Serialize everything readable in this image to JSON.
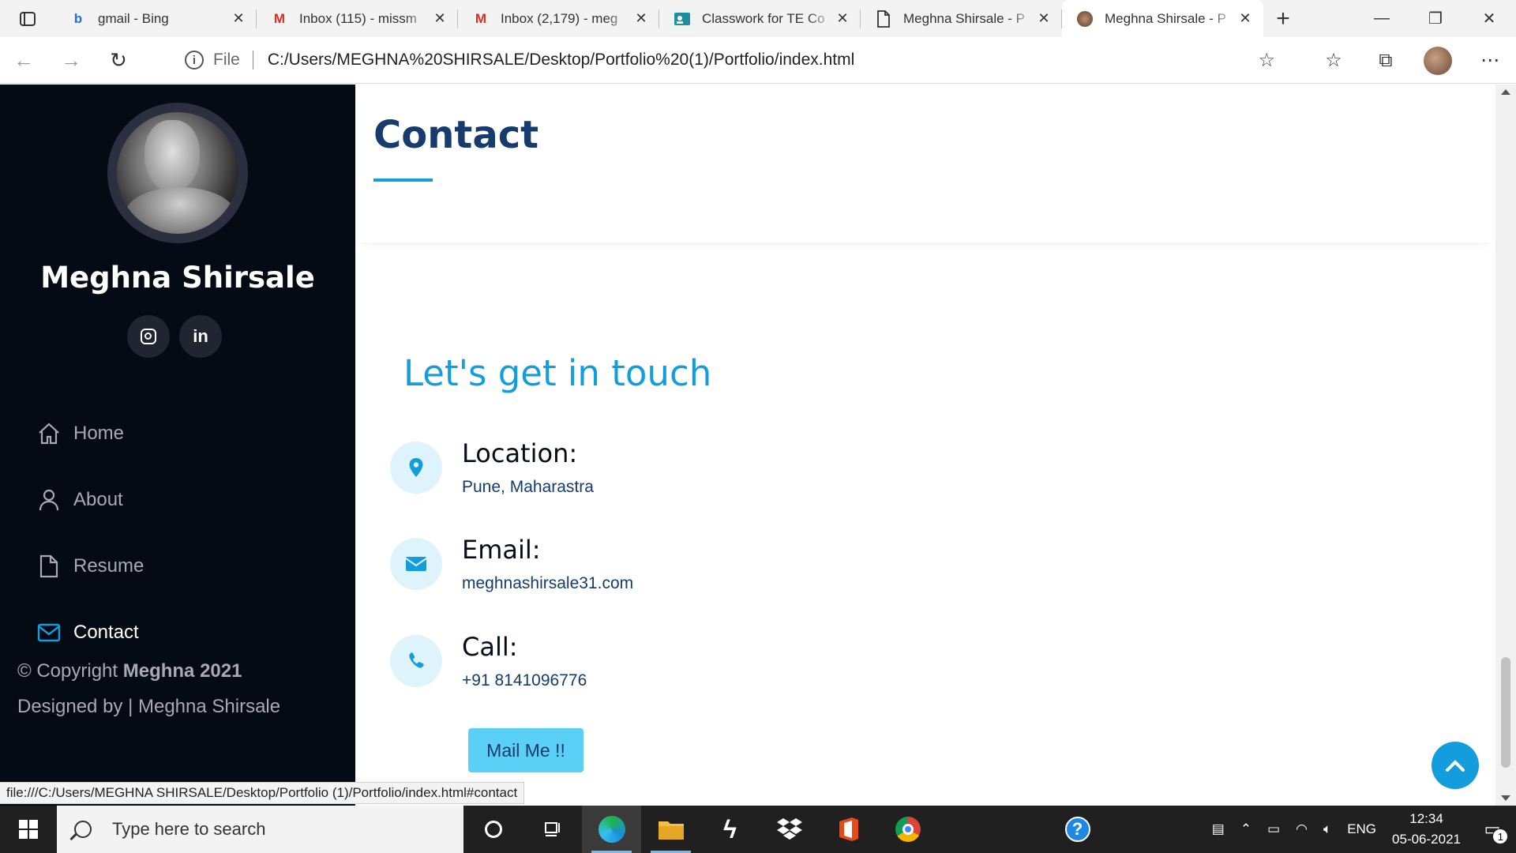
{
  "browser": {
    "tabs": [
      {
        "title": "gmail - Bing",
        "icon": "bing-icon"
      },
      {
        "title": "Inbox (115) - missm",
        "icon": "gmail-icon"
      },
      {
        "title": "Inbox (2,179) - meg",
        "icon": "gmail-icon"
      },
      {
        "title": "Classwork for TE Co",
        "icon": "classroom-icon"
      },
      {
        "title": "Meghna Shirsale - P",
        "icon": "document-icon"
      },
      {
        "title": "Meghna Shirsale - P",
        "icon": "profile-favicon",
        "active": true
      }
    ],
    "address": {
      "scheme_label": "File",
      "url": "C:/Users/MEGHNA%20SHIRSALE/Desktop/Portfolio%20(1)/Portfolio/index.html"
    },
    "status_url": "file:///C:/Users/MEGHNA SHIRSALE/Desktop/Portfolio (1)/Portfolio/index.html#contact"
  },
  "sidebar": {
    "name": "Meghna Shirsale",
    "social": [
      "instagram-icon",
      "linkedin-icon"
    ],
    "nav": [
      {
        "label": "Home",
        "icon": "home-icon"
      },
      {
        "label": "About",
        "icon": "user-icon"
      },
      {
        "label": "Resume",
        "icon": "file-icon"
      },
      {
        "label": "Contact",
        "icon": "envelope-icon",
        "active": true
      }
    ],
    "copyright_prefix": "© Copyright ",
    "copyright_name": "Meghna 2021",
    "designed_by": "Designed by | Meghna Shirsale"
  },
  "contact": {
    "title": "Contact",
    "tagline": "Let's get in touch",
    "location_label": "Location:",
    "location_value": "Pune, Maharastra",
    "email_label": "Email:",
    "email_value": "meghnashirsale31.com",
    "call_label": "Call:",
    "call_value": "+91 8141096776",
    "button_label": "Mail Me !!"
  },
  "taskbar": {
    "search_placeholder": "Type here to search",
    "language": "ENG",
    "time": "12:34",
    "date": "05-06-2021",
    "notification_count": "1"
  },
  "colors": {
    "accent": "#149ddd",
    "sidebar_bg": "#040b14",
    "heading": "#173b6c",
    "button": "#5bd0f7"
  }
}
